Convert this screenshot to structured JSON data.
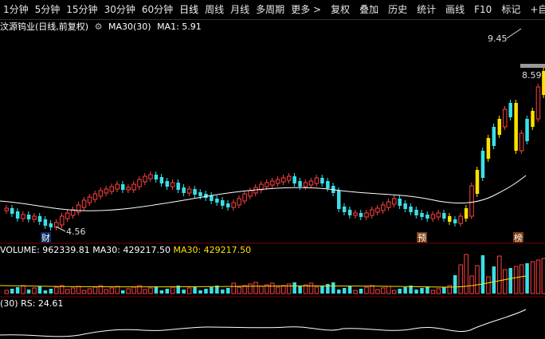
{
  "toolbar": {
    "items": [
      "1分钟",
      "5分钟",
      "15分钟",
      "30分钟",
      "60分钟",
      "日线",
      "周线",
      "月线",
      "多周期",
      "更多 >",
      "复权",
      "叠加",
      "历史",
      "统计",
      "画线",
      "F10",
      "标记",
      "+自"
    ]
  },
  "info": {
    "title": "汶源钨业(日线,前复权)",
    "ma_label": "MA30(30)",
    "ma1": "MA1: 5.91"
  },
  "price_labels": {
    "high": "9.45",
    "low": "4.56",
    "right_price": "8.59"
  },
  "events": {
    "cai": "财",
    "yu": "预",
    "bang": "榜"
  },
  "volume": {
    "vol": "VOLUME: 962339.81",
    "ma30": "MA30: 429217.50",
    "ma30b": "MA30: 429217.50"
  },
  "rs": {
    "label": "(30) RS: 24.61"
  },
  "colors": {
    "up": "#ff4040",
    "down": "#3ae0e8",
    "limit": "#ffe000",
    "ma": "#ffffff",
    "vol_ma": "#ffe000"
  }
}
